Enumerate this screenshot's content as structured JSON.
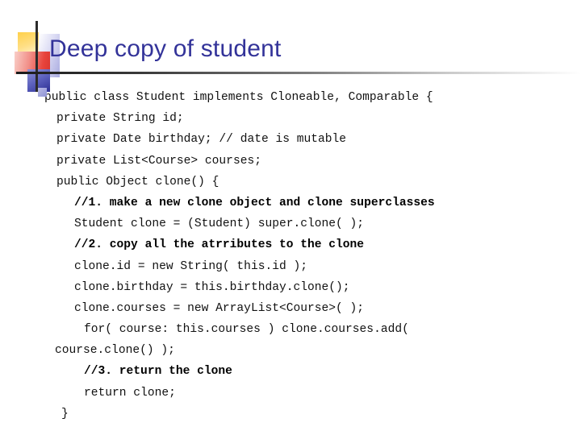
{
  "slide": {
    "title": "Deep copy of student",
    "title_color": "#333399",
    "decoration": {
      "name": "powerpoint-corner-motif",
      "yellow": "#ffd04a",
      "red": "#e8443c",
      "blue": "#2c2f93",
      "lavender": "#a9abe0",
      "rule_dark": "#1b1b1b"
    },
    "code": {
      "language": "java",
      "lines": [
        {
          "text": "public class Student implements Cloneable, Comparable {",
          "indent": "i0",
          "bold": false
        },
        {
          "text": "private String id;",
          "indent": "i1",
          "bold": false
        },
        {
          "text": "private Date birthday; // date is mutable",
          "indent": "i1",
          "bold": false
        },
        {
          "text": "private List<Course> courses;",
          "indent": "i1",
          "bold": false
        },
        {
          "text": "public Object clone() {",
          "indent": "i1",
          "bold": false
        },
        {
          "text": "//1. make a new clone object and clone superclasses",
          "indent": "i2",
          "bold": true
        },
        {
          "text": "Student clone = (Student) super.clone( );",
          "indent": "i2",
          "bold": false
        },
        {
          "text": "//2. copy all the atrributes to the clone",
          "indent": "i2",
          "bold": true
        },
        {
          "text": "clone.id = new String( this.id );",
          "indent": "i2",
          "bold": false
        },
        {
          "text": "clone.birthday = this.birthday.clone();",
          "indent": "i2",
          "bold": false
        },
        {
          "text": "clone.courses = new ArrayList<Course>( );",
          "indent": "i2",
          "bold": false
        },
        {
          "text": "for( course: this.courses ) clone.courses.add(",
          "indent": "i3",
          "bold": false
        },
        {
          "text": "course.clone() );",
          "indent": "iw",
          "bold": false
        },
        {
          "text": "//3. return the clone",
          "indent": "i3",
          "bold": true
        },
        {
          "text": "return clone;",
          "indent": "i3",
          "bold": false
        },
        {
          "text": "}",
          "indent": "ib",
          "bold": false
        }
      ]
    }
  }
}
